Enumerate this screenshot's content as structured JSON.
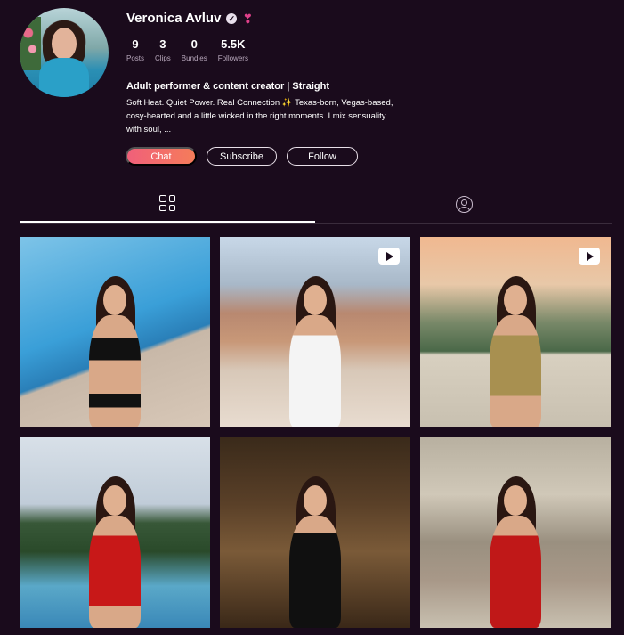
{
  "profile": {
    "name": "Veronica Avluv",
    "bio_title": "Adult performer & content creator | Straight",
    "bio_text": "Soft Heat. Quiet Power. Real Connection ✨ Texas-born, Vegas-based, cosy-hearted and a little wicked in the right moments. I mix sensuality with soul, ..."
  },
  "stats": [
    {
      "value": "9",
      "label": "Posts"
    },
    {
      "value": "3",
      "label": "Clips"
    },
    {
      "value": "0",
      "label": "Bundles"
    },
    {
      "value": "5.5K",
      "label": "Followers"
    }
  ],
  "actions": {
    "chat_label": "Chat",
    "subscribe_label": "Subscribe",
    "follow_label": "Follow"
  },
  "tabs": [
    {
      "icon": "grid-icon",
      "active": true
    },
    {
      "icon": "profile-icon",
      "active": false
    }
  ],
  "posts": [
    {
      "scene": "poolside black bikini",
      "is_video": false
    },
    {
      "scene": "city rooftop white dress",
      "is_video": true
    },
    {
      "scene": "balcony gold dress sunset",
      "is_video": true
    },
    {
      "scene": "fountain garden red bodysuit",
      "is_video": false
    },
    {
      "scene": "chandelier hall black gown",
      "is_video": false
    },
    {
      "scene": "courtyard red dress",
      "is_video": false
    }
  ],
  "colors": {
    "background": "#1a0b1c",
    "chat_gradient_start": "#f0607a",
    "chat_gradient_end": "#f57c5a",
    "badge_heart": "#e0408a"
  }
}
